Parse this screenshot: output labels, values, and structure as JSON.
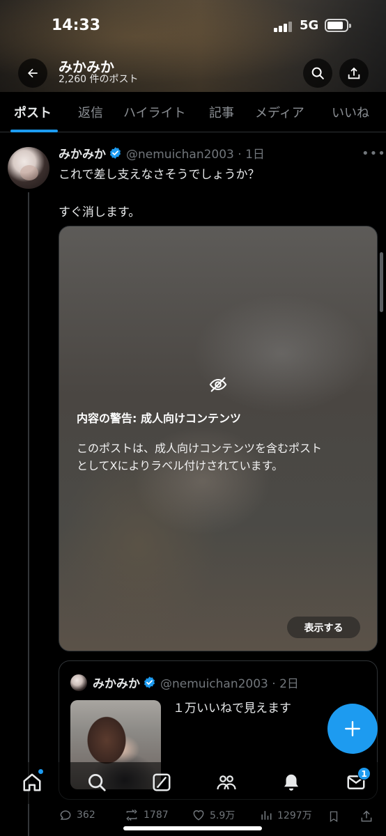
{
  "status_bar": {
    "time": "14:33",
    "network": "5G"
  },
  "header": {
    "name": "みかみか",
    "post_count": "2,260 件のポスト"
  },
  "tabs": [
    {
      "label": "ポスト",
      "active": true
    },
    {
      "label": "返信",
      "active": false
    },
    {
      "label": "ハイライト",
      "active": false
    },
    {
      "label": "記事",
      "active": false
    },
    {
      "label": "メディア",
      "active": false
    },
    {
      "label": "いいね",
      "active": false
    }
  ],
  "tweet": {
    "name": "みかみか",
    "handle_time": "@nemuichan2003 · 1日",
    "lines": [
      "これで差し支えなさそうでしょうか？",
      "すぐ消します。"
    ],
    "warning": {
      "title": "内容の警告: 成人向けコンテンツ",
      "body": [
        "このポストは、成人向けコンテンツを含むポスト",
        "としてXによりラベル付けされています。"
      ],
      "button": "表示する"
    },
    "quote": {
      "name": "みかみか",
      "handle_time": "@nemuichan2003 · 2日",
      "text": "１万いいねで見えます"
    },
    "stats": {
      "replies": "362",
      "reposts": "1787",
      "likes": "5.9万",
      "views": "1297万"
    }
  },
  "nav": {
    "messages_badge": "1"
  },
  "colors": {
    "accent": "#1d9bf0",
    "background": "#000000",
    "muted": "#71767b"
  }
}
